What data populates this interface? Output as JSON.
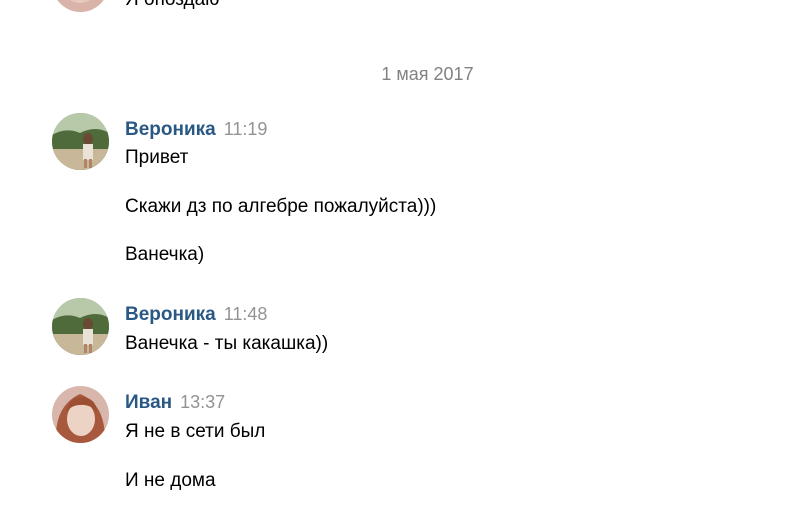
{
  "partial_message": "Я опоздаю",
  "date_separator": "1 мая 2017",
  "groups": [
    {
      "author": "Вероника",
      "time": "11:19",
      "messages": [
        "Привет",
        "Скажи дз по алгебре пожалуйста)))",
        "Ванечка)"
      ]
    },
    {
      "author": "Вероника",
      "time": "11:48",
      "messages": [
        "Ванечка - ты какашка))"
      ]
    },
    {
      "author": "Иван",
      "time": "13:37",
      "messages": [
        "Я не в сети был",
        "И не дома"
      ]
    }
  ],
  "colors": {
    "author": "#2a5885",
    "time": "#939393",
    "date_separator": "#828282"
  }
}
